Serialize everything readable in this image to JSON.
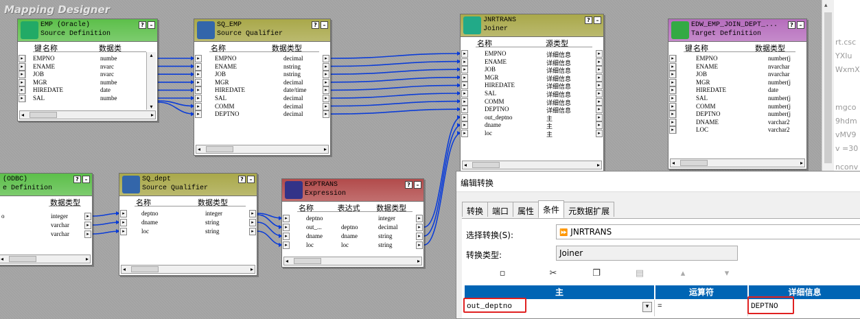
{
  "app": {
    "title": "Mapping Designer"
  },
  "help": {
    "q": "?",
    "m": "–"
  },
  "arrows": {
    "right": "▸",
    "left": "◂",
    "up": "▴",
    "down": "▾"
  },
  "emp_src": {
    "title1": "EMP (Oracle)",
    "title2": "Source Definition",
    "col_key": "键",
    "col_name": "名称",
    "col_type": "数据类",
    "rows": [
      {
        "name": "EMPNO",
        "type": "numbe"
      },
      {
        "name": "ENAME",
        "type": "nvarc"
      },
      {
        "name": "JOB",
        "type": "nvarc"
      },
      {
        "name": "MGR",
        "type": "numbe"
      },
      {
        "name": "HIREDATE",
        "type": "date"
      },
      {
        "name": "SAL",
        "type": "numbe"
      }
    ]
  },
  "sq_emp": {
    "title1": "SQ_EMP",
    "title2": "Source Qualifier",
    "col_name": "名称",
    "col_type": "数据类型",
    "rows": [
      {
        "name": "EMPNO",
        "type": "decimal"
      },
      {
        "name": "ENAME",
        "type": "nstring"
      },
      {
        "name": "JOB",
        "type": "nstring"
      },
      {
        "name": "MGR",
        "type": "decimal"
      },
      {
        "name": "HIREDATE",
        "type": "date/time"
      },
      {
        "name": "SAL",
        "type": "decimal"
      },
      {
        "name": "COMM",
        "type": "decimal"
      },
      {
        "name": "DEPTNO",
        "type": "decimal"
      }
    ]
  },
  "jnr": {
    "title1": "JNRTRANS",
    "title2": "Joiner",
    "col_name": "名称",
    "col_type": "源类型",
    "rows": [
      {
        "name": "EMPNO",
        "type": "详细信息"
      },
      {
        "name": "ENAME",
        "type": "详细信息"
      },
      {
        "name": "JOB",
        "type": "详细信息"
      },
      {
        "name": "MGR",
        "type": "详细信息"
      },
      {
        "name": "HIREDATE",
        "type": "详细信息"
      },
      {
        "name": "SAL",
        "type": "详细信息"
      },
      {
        "name": "COMM",
        "type": "详细信息"
      },
      {
        "name": "DEPTNO",
        "type": "详细信息"
      },
      {
        "name": "out_deptno",
        "type": "主"
      },
      {
        "name": "dname",
        "type": "主"
      },
      {
        "name": "loc",
        "type": "主"
      }
    ]
  },
  "tgt": {
    "title1": "EDW_EMP_JOIN_DEPT_...",
    "title2": "Target Definition",
    "col_key": "键",
    "col_name": "名称",
    "col_type": "数据类型",
    "rows": [
      {
        "name": "EMPNO",
        "type": "number(j"
      },
      {
        "name": "ENAME",
        "type": "nvarchar"
      },
      {
        "name": "JOB",
        "type": "nvarchar"
      },
      {
        "name": "MGR",
        "type": "number(j"
      },
      {
        "name": "HIREDATE",
        "type": "date"
      },
      {
        "name": "SAL",
        "type": "number(j"
      },
      {
        "name": "COMM",
        "type": "number(j"
      },
      {
        "name": "DEPTNO",
        "type": "number(j"
      },
      {
        "name": "DNAME",
        "type": "varchar2"
      },
      {
        "name": "LOC",
        "type": "varchar2"
      }
    ]
  },
  "dept_src": {
    "title1": "(ODBC)",
    "title2": "e Definition",
    "col_type": "数据类型",
    "rows": [
      {
        "name": "o",
        "type": "integer"
      },
      {
        "name": "",
        "type": "varchar"
      },
      {
        "name": "",
        "type": "varchar"
      }
    ]
  },
  "sq_dept": {
    "title1": "SQ_dept",
    "title2": "Source Qualifier",
    "col_name": "名称",
    "col_type": "数据类型",
    "rows": [
      {
        "name": "deptno",
        "type": "integer"
      },
      {
        "name": "dname",
        "type": "string"
      },
      {
        "name": "loc",
        "type": "string"
      }
    ]
  },
  "exp": {
    "title1": "EXPTRANS",
    "title2": "Expression",
    "col_name": "名称",
    "col_expr": "表达式",
    "col_type": "数据类型",
    "rows": [
      {
        "name": "deptno",
        "expr": "",
        "type": "integer"
      },
      {
        "name": "out_...",
        "expr": "deptno",
        "type": "decimal"
      },
      {
        "name": "dname",
        "expr": "dname",
        "type": "string"
      },
      {
        "name": "loc",
        "expr": "loc",
        "type": "string"
      }
    ]
  },
  "bg_text": {
    "lines": [
      "rt.csc",
      "YXIu",
      "WxmX",
      "mgco",
      "9hdm",
      "vMV9",
      "v =30",
      "nconv"
    ]
  },
  "dialog": {
    "title": "编辑转换",
    "tabs": [
      "转换",
      "端口",
      "属性",
      "条件",
      "元数据扩展"
    ],
    "active_tab": 3,
    "select_label": "选择转换(S):",
    "select_value": "JNRTRANS",
    "type_label": "转换类型:",
    "type_value": "Joiner",
    "toolbar": [
      "new-icon",
      "cut-icon",
      "copy-icon",
      "paste-icon",
      "move-up-icon",
      "move-down-icon"
    ],
    "grid": {
      "headers": [
        "主",
        "运算符",
        "详细信息"
      ],
      "row": {
        "master": "out_deptno",
        "op": "=",
        "detail": "DEPTNO"
      }
    }
  }
}
